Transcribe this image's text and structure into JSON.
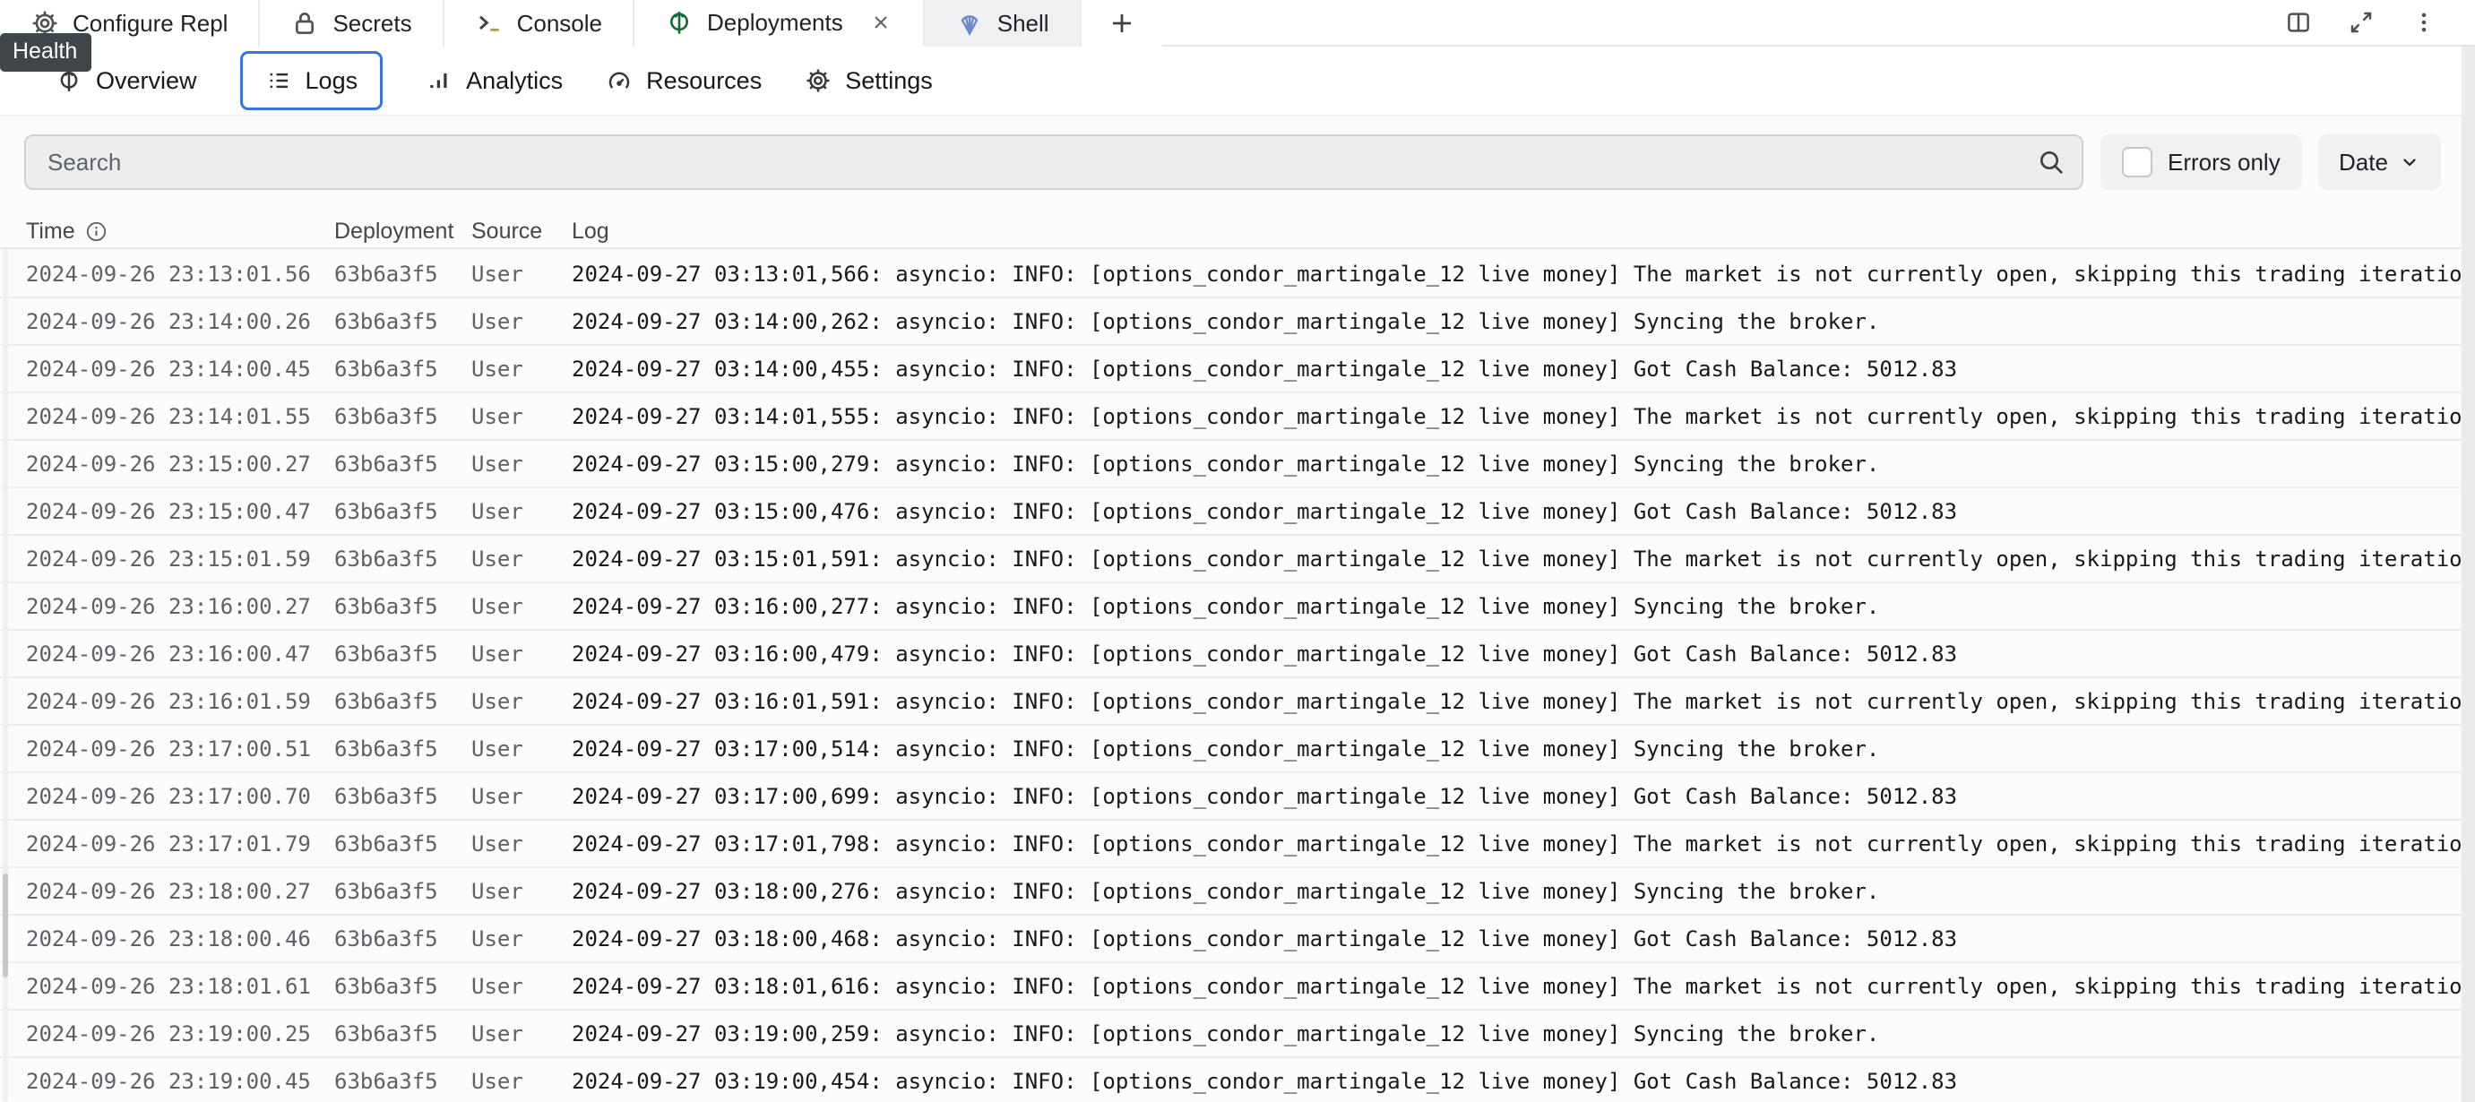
{
  "tab_bar": {
    "tabs": [
      {
        "label": "Configure Repl"
      },
      {
        "label": "Secrets"
      },
      {
        "label": "Console"
      },
      {
        "label": "Deployments",
        "active": true
      },
      {
        "label": "Shell"
      }
    ],
    "new_tab_label": "+"
  },
  "window_controls": {
    "icons": [
      "split-view",
      "expand",
      "more-options"
    ]
  },
  "tooltip": {
    "label": "Health"
  },
  "nav": {
    "items": [
      {
        "label": "Overview"
      },
      {
        "label": "Logs",
        "selected": true
      },
      {
        "label": "Analytics"
      },
      {
        "label": "Resources"
      },
      {
        "label": "Settings"
      }
    ]
  },
  "filters": {
    "search_placeholder": "Search",
    "errors_only_label": "Errors only",
    "errors_only_checked": false,
    "date_label": "Date"
  },
  "table": {
    "headers": {
      "time": "Time",
      "deployment": "Deployment",
      "source": "Source",
      "log": "Log"
    },
    "rows": [
      {
        "time": "2024-09-26 23:13:01.56",
        "deployment": "63b6a3f5",
        "source": "User",
        "log": "2024-09-27 03:13:01,566: asyncio: INFO: [options_condor_martingale_12 live money] The market is not currently open, skipping this trading iteratio"
      },
      {
        "time": "2024-09-26 23:14:00.26",
        "deployment": "63b6a3f5",
        "source": "User",
        "log": "2024-09-27 03:14:00,262: asyncio: INFO: [options_condor_martingale_12 live money] Syncing the broker."
      },
      {
        "time": "2024-09-26 23:14:00.45",
        "deployment": "63b6a3f5",
        "source": "User",
        "log": "2024-09-27 03:14:00,455: asyncio: INFO: [options_condor_martingale_12 live money] Got Cash Balance: 5012.83"
      },
      {
        "time": "2024-09-26 23:14:01.55",
        "deployment": "63b6a3f5",
        "source": "User",
        "log": "2024-09-27 03:14:01,555: asyncio: INFO: [options_condor_martingale_12 live money] The market is not currently open, skipping this trading iteratio"
      },
      {
        "time": "2024-09-26 23:15:00.27",
        "deployment": "63b6a3f5",
        "source": "User",
        "log": "2024-09-27 03:15:00,279: asyncio: INFO: [options_condor_martingale_12 live money] Syncing the broker."
      },
      {
        "time": "2024-09-26 23:15:00.47",
        "deployment": "63b6a3f5",
        "source": "User",
        "log": "2024-09-27 03:15:00,476: asyncio: INFO: [options_condor_martingale_12 live money] Got Cash Balance: 5012.83"
      },
      {
        "time": "2024-09-26 23:15:01.59",
        "deployment": "63b6a3f5",
        "source": "User",
        "log": "2024-09-27 03:15:01,591: asyncio: INFO: [options_condor_martingale_12 live money] The market is not currently open, skipping this trading iteratio"
      },
      {
        "time": "2024-09-26 23:16:00.27",
        "deployment": "63b6a3f5",
        "source": "User",
        "log": "2024-09-27 03:16:00,277: asyncio: INFO: [options_condor_martingale_12 live money] Syncing the broker."
      },
      {
        "time": "2024-09-26 23:16:00.47",
        "deployment": "63b6a3f5",
        "source": "User",
        "log": "2024-09-27 03:16:00,479: asyncio: INFO: [options_condor_martingale_12 live money] Got Cash Balance: 5012.83"
      },
      {
        "time": "2024-09-26 23:16:01.59",
        "deployment": "63b6a3f5",
        "source": "User",
        "log": "2024-09-27 03:16:01,591: asyncio: INFO: [options_condor_martingale_12 live money] The market is not currently open, skipping this trading iteratio"
      },
      {
        "time": "2024-09-26 23:17:00.51",
        "deployment": "63b6a3f5",
        "source": "User",
        "log": "2024-09-27 03:17:00,514: asyncio: INFO: [options_condor_martingale_12 live money] Syncing the broker."
      },
      {
        "time": "2024-09-26 23:17:00.70",
        "deployment": "63b6a3f5",
        "source": "User",
        "log": "2024-09-27 03:17:00,699: asyncio: INFO: [options_condor_martingale_12 live money] Got Cash Balance: 5012.83"
      },
      {
        "time": "2024-09-26 23:17:01.79",
        "deployment": "63b6a3f5",
        "source": "User",
        "log": "2024-09-27 03:17:01,798: asyncio: INFO: [options_condor_martingale_12 live money] The market is not currently open, skipping this trading iteratio"
      },
      {
        "time": "2024-09-26 23:18:00.27",
        "deployment": "63b6a3f5",
        "source": "User",
        "log": "2024-09-27 03:18:00,276: asyncio: INFO: [options_condor_martingale_12 live money] Syncing the broker."
      },
      {
        "time": "2024-09-26 23:18:00.46",
        "deployment": "63b6a3f5",
        "source": "User",
        "log": "2024-09-27 03:18:00,468: asyncio: INFO: [options_condor_martingale_12 live money] Got Cash Balance: 5012.83"
      },
      {
        "time": "2024-09-26 23:18:01.61",
        "deployment": "63b6a3f5",
        "source": "User",
        "log": "2024-09-27 03:18:01,616: asyncio: INFO: [options_condor_martingale_12 live money] The market is not currently open, skipping this trading iteratio"
      },
      {
        "time": "2024-09-26 23:19:00.25",
        "deployment": "63b6a3f5",
        "source": "User",
        "log": "2024-09-27 03:19:00,259: asyncio: INFO: [options_condor_martingale_12 live money] Syncing the broker."
      },
      {
        "time": "2024-09-26 23:19:00.45",
        "deployment": "63b6a3f5",
        "source": "User",
        "log": "2024-09-27 03:19:00,454: asyncio: INFO: [options_condor_martingale_12 live money] Got Cash Balance: 5012.83"
      }
    ]
  },
  "colors": {
    "accent_blue": "#3575e3",
    "deployments_green": "#186b38",
    "shell_blue": "#6e89c7",
    "tooltip_bg": "#40454a"
  }
}
